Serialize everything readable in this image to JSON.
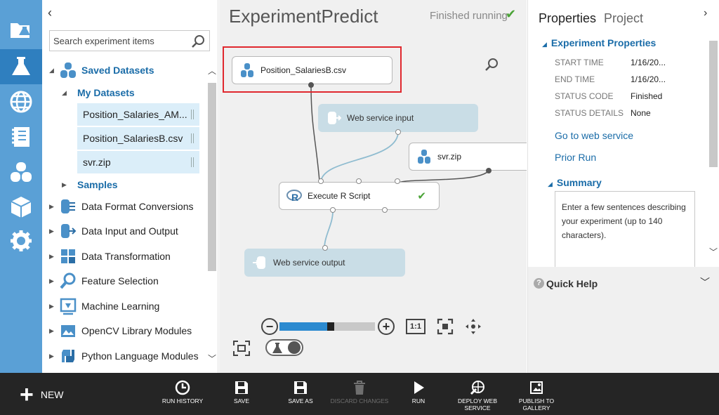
{
  "palette": {
    "search_placeholder": "Search experiment items",
    "saved_datasets": "Saved Datasets",
    "my_datasets": "My Datasets",
    "datasets": [
      "Position_Salaries_AM...",
      "Position_SalariesB.csv",
      "svr.zip"
    ],
    "samples": "Samples",
    "categories": [
      {
        "label": "Data Format Conversions",
        "icon": "format-conversion-icon"
      },
      {
        "label": "Data Input and Output",
        "icon": "data-io-icon"
      },
      {
        "label": "Data Transformation",
        "icon": "transformation-icon"
      },
      {
        "label": "Feature Selection",
        "icon": "feature-selection-icon"
      },
      {
        "label": "Machine Learning",
        "icon": "machine-learning-icon"
      },
      {
        "label": "OpenCV Library Modules",
        "icon": "opencv-icon"
      },
      {
        "label": "Python Language Modules",
        "icon": "python-icon"
      }
    ]
  },
  "canvas": {
    "title": "ExperimentPredict",
    "status": "Finished running",
    "nodes": {
      "dataset": "Position_SalariesB.csv",
      "ws_input": "Web service input",
      "svr": "svr.zip",
      "rscript": "Execute R Script",
      "ws_output": "Web service output"
    },
    "zoom_level": 0.5,
    "actual_size_label": "1:1"
  },
  "properties": {
    "tab_properties": "Properties",
    "tab_project": "Project",
    "section_title": "Experiment Properties",
    "rows": [
      {
        "key": "START TIME",
        "value": "1/16/20..."
      },
      {
        "key": "END TIME",
        "value": "1/16/20..."
      },
      {
        "key": "STATUS CODE",
        "value": "Finished"
      },
      {
        "key": "STATUS DETAILS",
        "value": "None"
      }
    ],
    "link_web_service": "Go to web service",
    "link_prior_run": "Prior Run",
    "summary_title": "Summary",
    "summary_placeholder": "Enter a few sentences describing your experiment (up to 140 characters).",
    "quick_help": "Quick Help"
  },
  "toolbar": {
    "new": "NEW",
    "run_history": "RUN HISTORY",
    "save": "SAVE",
    "save_as": "SAVE AS",
    "discard": "DISCARD CHANGES",
    "run": "RUN",
    "deploy": "DEPLOY WEB SERVICE",
    "publish": "PUBLISH TO GALLERY"
  },
  "colors": {
    "accent": "#1a6ca8",
    "rail": "#5aa0d6",
    "rail_active": "#2f7fbf",
    "highlight": "#e0282e",
    "success": "#4aa336"
  }
}
